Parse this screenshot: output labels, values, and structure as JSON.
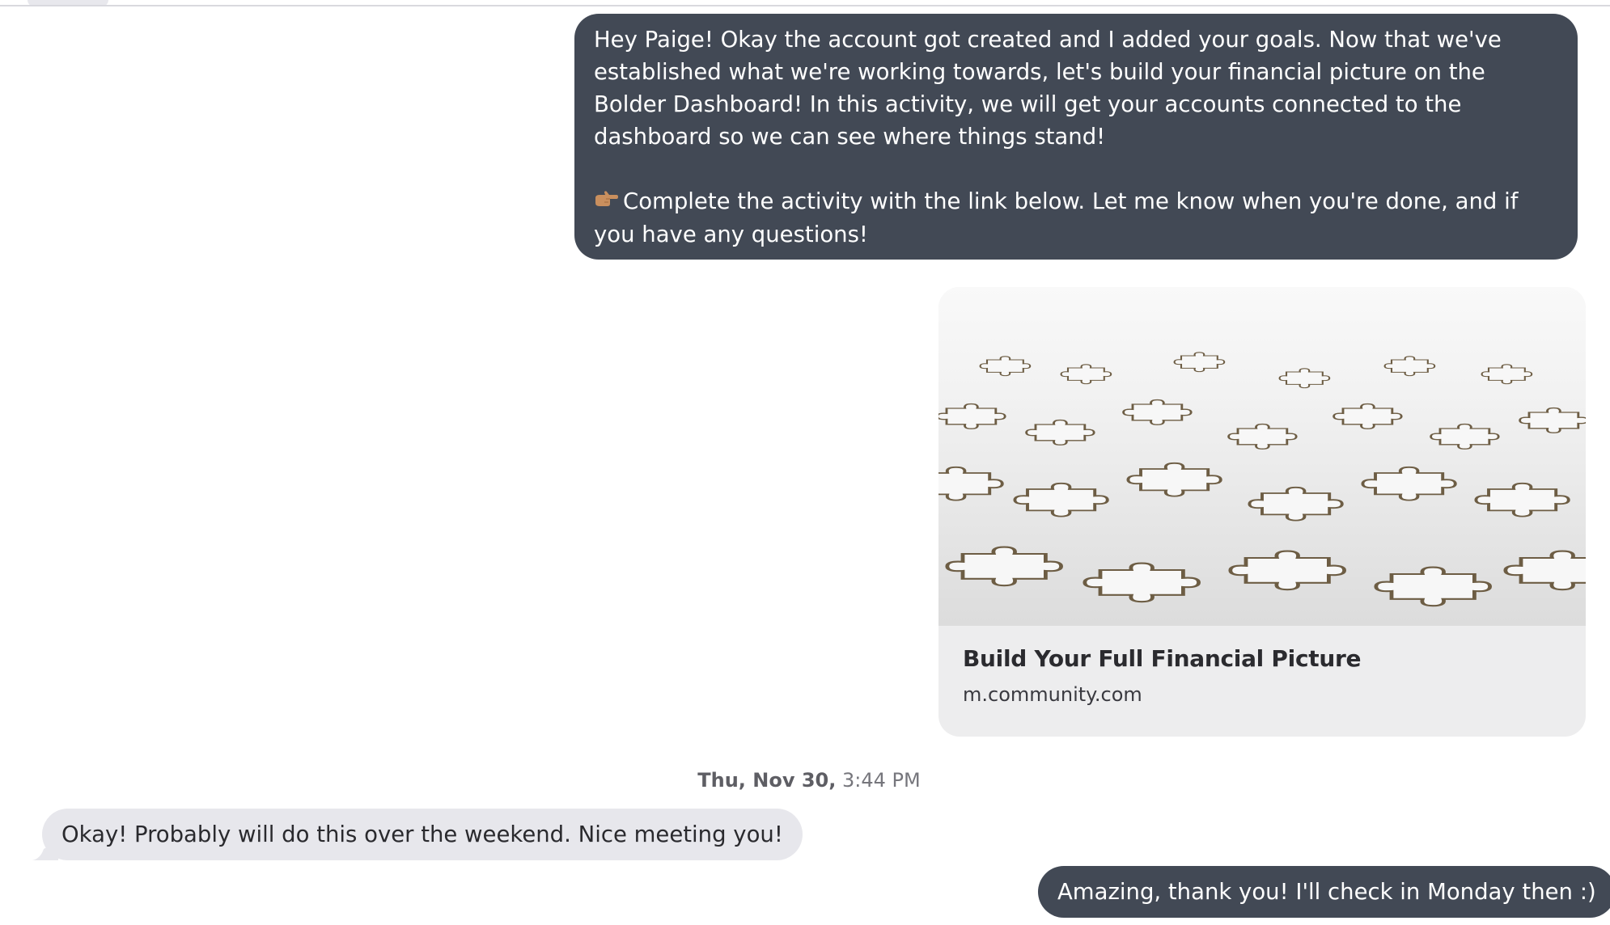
{
  "conversation": {
    "messages": [
      {
        "direction": "outgoing",
        "paragraph_1": "Hey Paige! Okay the account got created and I added your goals. Now that we've established what we're working towards, let's build your financial picture on the Bolder Dashboard! In this activity, we will get your accounts connected to the dashboard so we can see where things stand!",
        "paragraph_2_icon": "pointing-hand-icon",
        "paragraph_2": "Complete the activity with the link below. Let me know when you're done, and if you have any questions!"
      },
      {
        "direction": "outgoing",
        "link_preview": {
          "image": "puzzle-pieces-photo",
          "title": "Build Your Full Financial Picture",
          "domain": "m.community.com"
        }
      },
      {
        "direction": "incoming",
        "text": "Okay! Probably will do this over the weekend. Nice meeting you!"
      },
      {
        "direction": "outgoing",
        "text": "Amazing, thank you! I'll check in Monday then :)"
      }
    ],
    "timestamp": {
      "day": "Thu, Nov 30,",
      "time": "3:44 PM"
    }
  },
  "colors": {
    "outgoing_bubble": "#424955",
    "incoming_bubble": "#e7e7ec",
    "link_card_bg": "#ededee",
    "timestamp_text": "#76767c"
  }
}
